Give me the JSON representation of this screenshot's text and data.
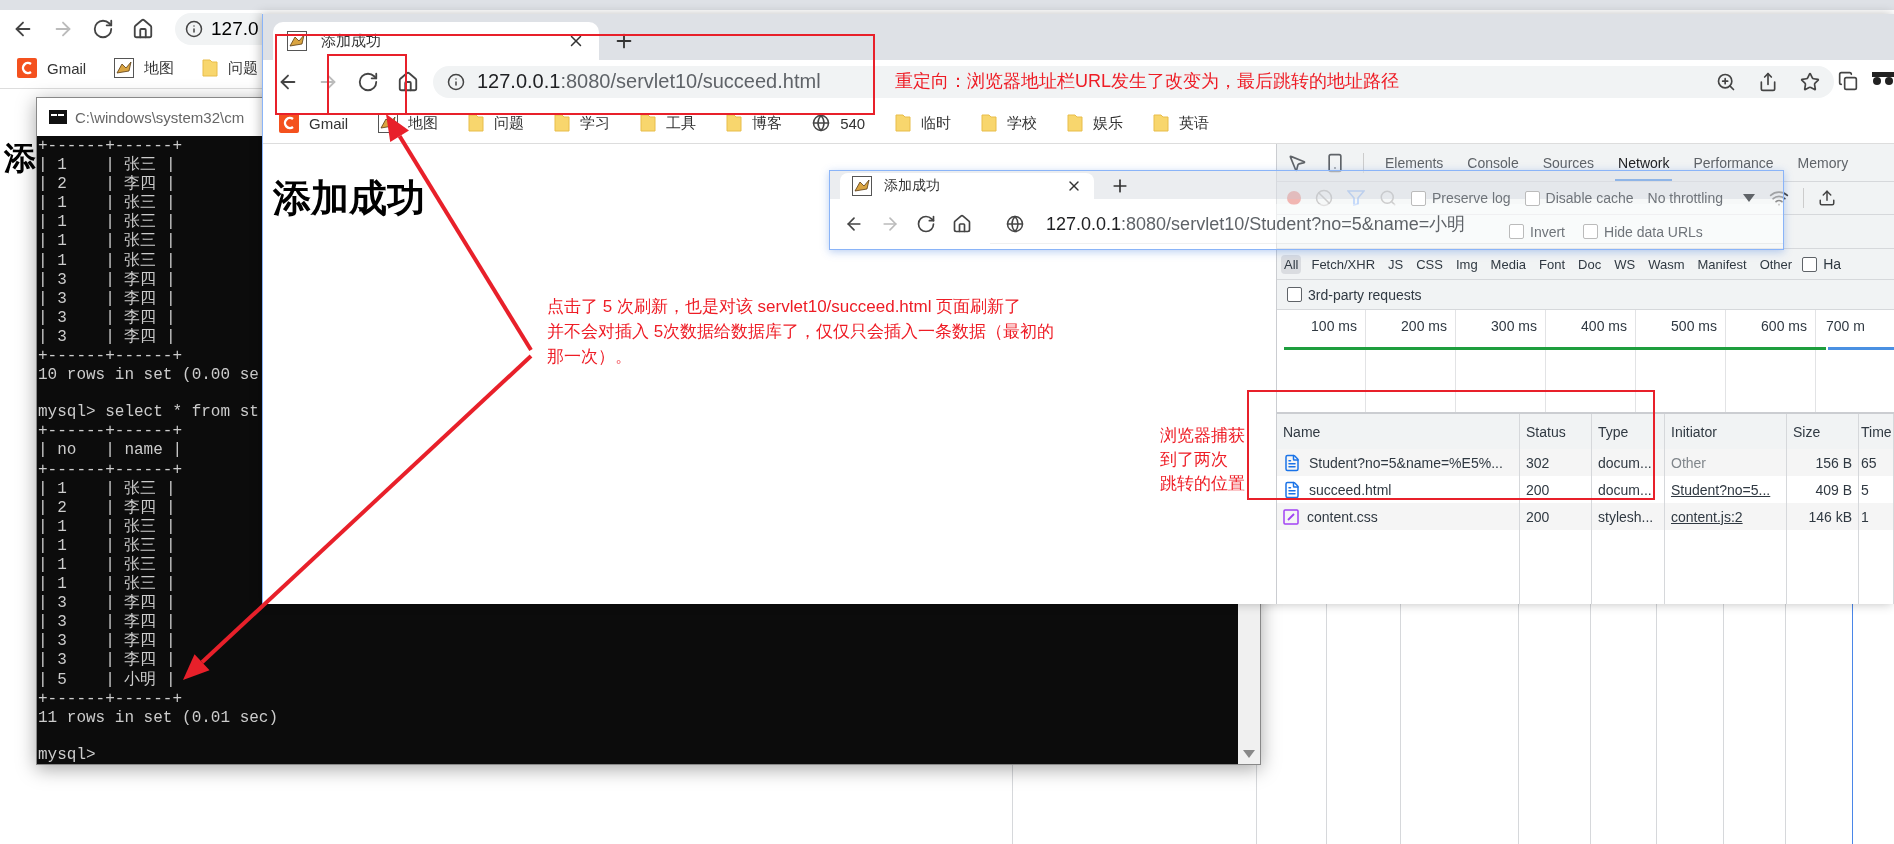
{
  "back_browser": {
    "url": "127.0",
    "bookmarks": [
      {
        "kind": "logo",
        "label": "Gmail"
      },
      {
        "kind": "favicon",
        "label": "地图"
      },
      {
        "kind": "folder",
        "label": "问题"
      }
    ],
    "heading": "添"
  },
  "terminal": {
    "title": "C:\\windows\\system32\\cm",
    "blocks": [
      {
        "lines": [
          "+------+------+",
          "| 1    | 张三 |",
          "| 2    | 李四 |",
          "| 1    | 张三 |",
          "| 1    | 张三 |",
          "| 1    | 张三 |",
          "| 1    | 张三 |",
          "| 3    | 李四 |",
          "| 3    | 李四 |",
          "| 3    | 李四 |",
          "| 3    | 李四 |",
          "+------+------+",
          "10 rows in set (0.00 se"
        ]
      },
      {
        "lines": [
          "mysql> select * from st",
          "+------+------+",
          "| no   | name |",
          "+------+------+",
          "| 1    | 张三 |",
          "| 2    | 李四 |",
          "| 1    | 张三 |",
          "| 1    | 张三 |",
          "| 1    | 张三 |",
          "| 1    | 张三 |",
          "| 3    | 李四 |",
          "| 3    | 李四 |",
          "| 3    | 李四 |",
          "| 3    | 李四 |",
          "| 5    | 小明 |",
          "+------+------+",
          "11 rows in set (0.01 sec)"
        ]
      },
      {
        "lines": [
          "mysql>"
        ]
      }
    ]
  },
  "browser": {
    "tab": {
      "title": "添加成功",
      "selected": true
    },
    "url": {
      "host": "127.0.0.1",
      "path": ":8080/servlet10/succeed.html"
    },
    "bookmarks": [
      {
        "kind": "logo",
        "label": "Gmail"
      },
      {
        "kind": "favicon",
        "label": "地图"
      },
      {
        "kind": "folder",
        "label": "问题"
      },
      {
        "kind": "folder",
        "label": "学习"
      },
      {
        "kind": "folder",
        "label": "工具"
      },
      {
        "kind": "folder",
        "label": "博客"
      },
      {
        "kind": "globe",
        "label": "540"
      },
      {
        "kind": "folder",
        "label": "临时"
      },
      {
        "kind": "folder",
        "label": "学校"
      },
      {
        "kind": "folder",
        "label": "娱乐"
      },
      {
        "kind": "folder",
        "label": "英语"
      }
    ],
    "heading": "添加成功",
    "devtools": {
      "tabs": [
        {
          "label": "Elements",
          "selected": false
        },
        {
          "label": "Console",
          "selected": false
        },
        {
          "label": "Sources",
          "selected": false
        },
        {
          "label": "Network",
          "selected": true
        },
        {
          "label": "Performance",
          "selected": false
        },
        {
          "label": "Memory",
          "selected": false
        }
      ],
      "toolbar": {
        "preserve_log": {
          "label": "Preserve log",
          "checked": false
        },
        "disable_cache": {
          "label": "Disable cache",
          "checked": false
        },
        "throttling": "No throttling"
      },
      "filter_options": [
        {
          "label": "Invert",
          "checked": false
        },
        {
          "label": "Hide data URLs",
          "checked": false
        }
      ],
      "type_filters": [
        {
          "label": "All",
          "selected": true
        },
        {
          "label": "Fetch/XHR",
          "selected": false
        },
        {
          "label": "JS",
          "selected": false
        },
        {
          "label": "CSS",
          "selected": false
        },
        {
          "label": "Img",
          "selected": false
        },
        {
          "label": "Media",
          "selected": false
        },
        {
          "label": "Font",
          "selected": false
        },
        {
          "label": "Doc",
          "selected": false
        },
        {
          "label": "WS",
          "selected": false
        },
        {
          "label": "Wasm",
          "selected": false
        },
        {
          "label": "Manifest",
          "selected": false
        },
        {
          "label": "Other",
          "selected": false
        }
      ],
      "blocked_option": {
        "label": "Ha",
        "checked": false
      },
      "third_party": {
        "label": "3rd-party requests",
        "checked": false
      },
      "timeline_ticks": [
        "100 ms",
        "200 ms",
        "300 ms",
        "400 ms",
        "500 ms",
        "600 ms",
        "700 m"
      ],
      "table": {
        "columns": [
          "Name",
          "Status",
          "Type",
          "Initiator",
          "Size",
          "Time"
        ],
        "rows": [
          {
            "kind": "document",
            "name": "Student?no=5&name=%E5%...",
            "status": "302",
            "type": "docum...",
            "initiator": "Other",
            "initiator_link": false,
            "size": "156 B",
            "time": "65"
          },
          {
            "kind": "document",
            "name": "succeed.html",
            "status": "200",
            "type": "docum...",
            "initiator": "Student?no=5...",
            "initiator_link": true,
            "size": "409 B",
            "time": "5"
          },
          {
            "kind": "stylesheet",
            "name": "content.css",
            "status": "200",
            "type": "stylesh...",
            "initiator": "content.js:2",
            "initiator_link": true,
            "size": "146 kB",
            "time": "1"
          }
        ]
      }
    }
  },
  "popup_browser": {
    "tab_title": "添加成功",
    "url": {
      "host": "127.0.0.1",
      "path": ":8080/servlet10/Student?no=5&name=小明"
    }
  },
  "annotations": {
    "redirect_note": "重定向：浏览器地址栏URL发生了改变为，最后跳转的地址路径",
    "refresh_note": [
      "点击了 5 次刷新，也是对该 servlet10/succeed.html 页面刷新了",
      "并不会对插入 5次数据给数据库了，仅仅只会插入一条数据（最初的",
      "那一次）。"
    ],
    "capture_note": [
      "浏览器捕获",
      "到了两次",
      "跳转的位置"
    ]
  }
}
